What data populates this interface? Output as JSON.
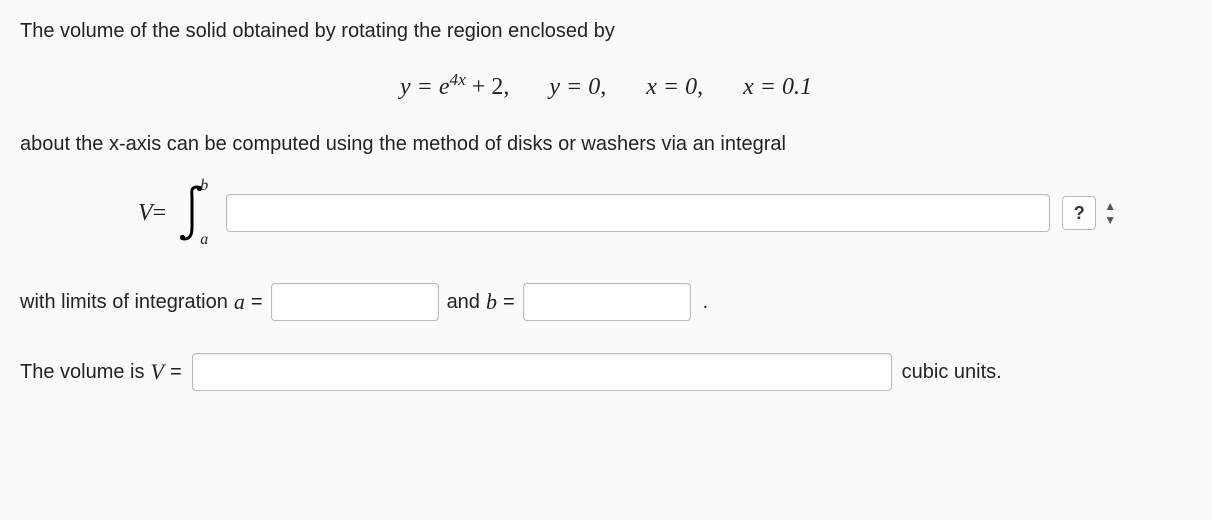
{
  "intro": "The volume of the solid obtained by rotating the region enclosed by",
  "equation": {
    "y_expr_lhs": "y = e",
    "y_expr_sup": "4x",
    "y_expr_rhs": " + 2,",
    "y_zero": "y = 0,",
    "x_zero": "x = 0,",
    "x_end": "x = 0.1"
  },
  "about_line": "about the x-axis can be computed using the method of disks or washers via an integral",
  "integral": {
    "V_label": "V",
    "equals": " = ",
    "upper": "b",
    "lower": "a",
    "integrand_value": ""
  },
  "help_label": "?",
  "limits": {
    "prefix": "with limits of integration ",
    "a_label": "a",
    "eq": " = ",
    "a_value": "",
    "and": " and ",
    "b_label": "b",
    "b_value": "",
    "dot": "."
  },
  "volume": {
    "prefix": "The volume is ",
    "V_label": "V",
    "eq": " = ",
    "value": "",
    "suffix": "cubic units."
  }
}
